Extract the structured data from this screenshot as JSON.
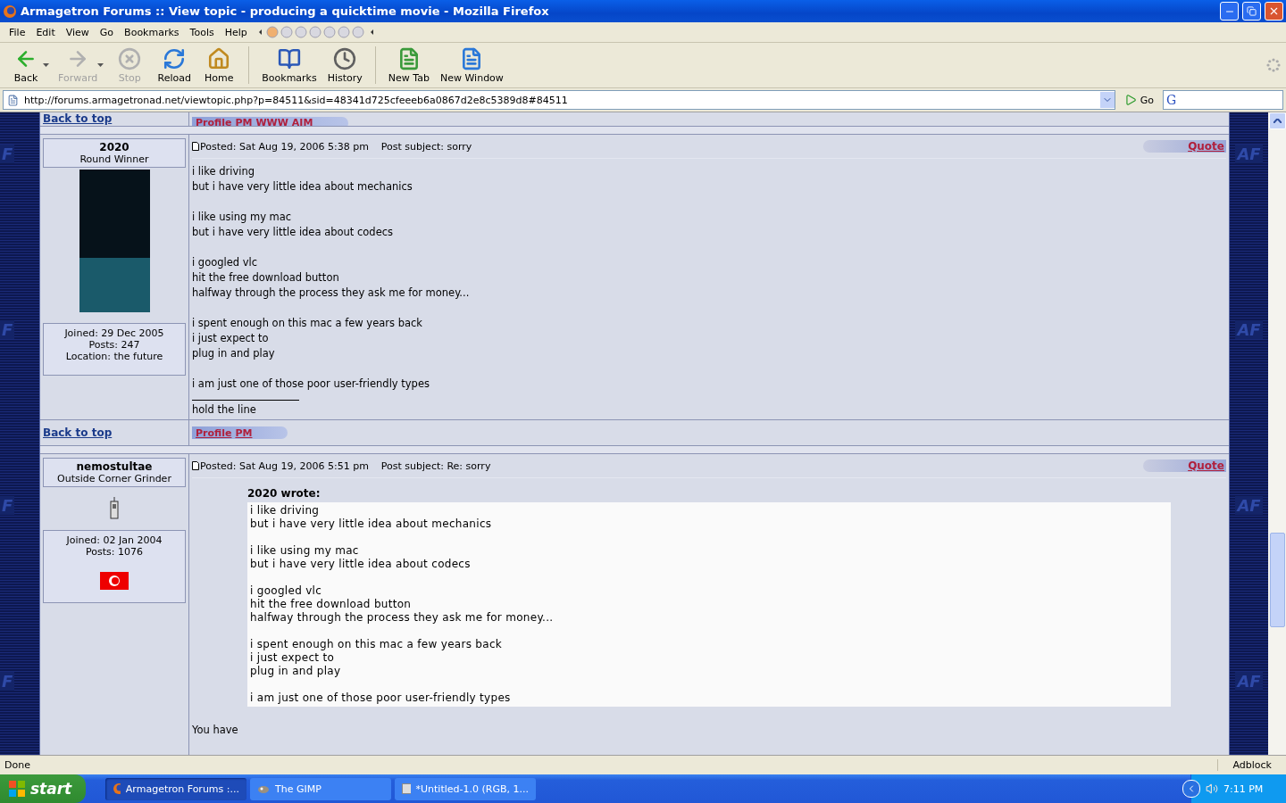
{
  "window": {
    "title": "Armagetron Forums :: View topic - producing a quicktime movie - Mozilla Firefox"
  },
  "menu": [
    "File",
    "Edit",
    "View",
    "Go",
    "Bookmarks",
    "Tools",
    "Help"
  ],
  "toolbar": [
    {
      "label": "Back",
      "kind": "back",
      "disabled": false,
      "has_menu": true
    },
    {
      "label": "Forward",
      "kind": "forward",
      "disabled": true,
      "has_menu": true
    },
    {
      "label": "Stop",
      "kind": "stop",
      "disabled": true,
      "has_menu": false
    },
    {
      "label": "Reload",
      "kind": "reload",
      "disabled": false,
      "has_menu": false
    },
    {
      "label": "Home",
      "kind": "home",
      "disabled": false,
      "has_menu": false
    },
    {
      "label": "Bookmarks",
      "kind": "bookmarks",
      "disabled": false,
      "has_menu": false
    },
    {
      "label": "History",
      "kind": "history",
      "disabled": false,
      "has_menu": false
    },
    {
      "label": "New Tab",
      "kind": "newtab",
      "disabled": false,
      "has_menu": false
    },
    {
      "label": "New Window",
      "kind": "newwindow",
      "disabled": false,
      "has_menu": false
    }
  ],
  "address_bar": {
    "value": "http://forums.armagetronad.net/viewtopic.php?p=84511&sid=48341d725cfeeeb6a0867d2e8c5389d8#84511",
    "go_label": "Go",
    "search_engine": "G"
  },
  "side_marks": {
    "left": [
      "F",
      "F",
      "F",
      "F"
    ],
    "right": [
      "AF",
      "AF",
      "AF",
      "AF"
    ]
  },
  "top_row": {
    "back_to_top": "Back to top",
    "buttons": [
      "Profile",
      "PM",
      "WWW",
      "AIM"
    ]
  },
  "posts": [
    {
      "author": "2020",
      "rank": "Round Winner",
      "kind": "photo",
      "details": [
        "Joined: 29 Dec 2005",
        "Posts: 247",
        "Location: the future"
      ],
      "flag": false,
      "header": "Posted: Sat Aug 19, 2006 5:38 pm",
      "subject": "Post subject: sorry",
      "quote_button": "Quote",
      "paragraphs": [
        [
          "i like driving",
          "but i have very little idea about mechanics"
        ],
        [
          "i like using my mac",
          "but i have very little idea about codecs"
        ],
        [
          "i googled vlc",
          "hit the free download button",
          "halfway through the process they ask me for money..."
        ],
        [
          "i spent enough on this mac a few years back",
          "i just expect to",
          "plug in and play"
        ],
        [
          "i am just one of those poor user-friendly types"
        ]
      ],
      "signature": "hold the line",
      "footer": {
        "back_to_top": "Back to top",
        "buttons": [
          "Profile",
          "PM"
        ]
      }
    },
    {
      "author": "nemostultae",
      "rank": "Outside Corner Grinder",
      "kind": "icon",
      "details": [
        "Joined: 02 Jan 2004",
        "Posts: 1076"
      ],
      "flag": true,
      "header": "Posted: Sat Aug 19, 2006 5:51 pm",
      "subject": "Post subject: Re: sorry",
      "quote_button": "Quote",
      "quote": {
        "author": "2020 wrote:",
        "paragraphs": [
          [
            "i like driving",
            "but i have very little idea about mechanics"
          ],
          [
            "i like using my mac",
            "but i have very little idea about codecs"
          ],
          [
            "i googled vlc",
            "hit the free download button",
            "halfway through the process they ask me for money..."
          ],
          [
            "i spent enough on this mac a few years back",
            "i just expect to",
            "plug in and play"
          ],
          [
            "i am just one of those poor user-friendly types"
          ]
        ]
      },
      "paragraphs": [
        [
          "You have"
        ]
      ]
    }
  ],
  "status_bar": {
    "text": "Done",
    "panel": "Adblock"
  },
  "taskbar": {
    "start": "start",
    "tasks": [
      {
        "label": "Armagetron Forums :...",
        "kind": "firefox",
        "selected": true
      },
      {
        "label": "The GIMP",
        "kind": "gimp",
        "selected": false
      },
      {
        "label": "*Untitled-1.0 (RGB, 1...",
        "kind": "image",
        "selected": false
      }
    ],
    "clock": "7:11 PM"
  }
}
